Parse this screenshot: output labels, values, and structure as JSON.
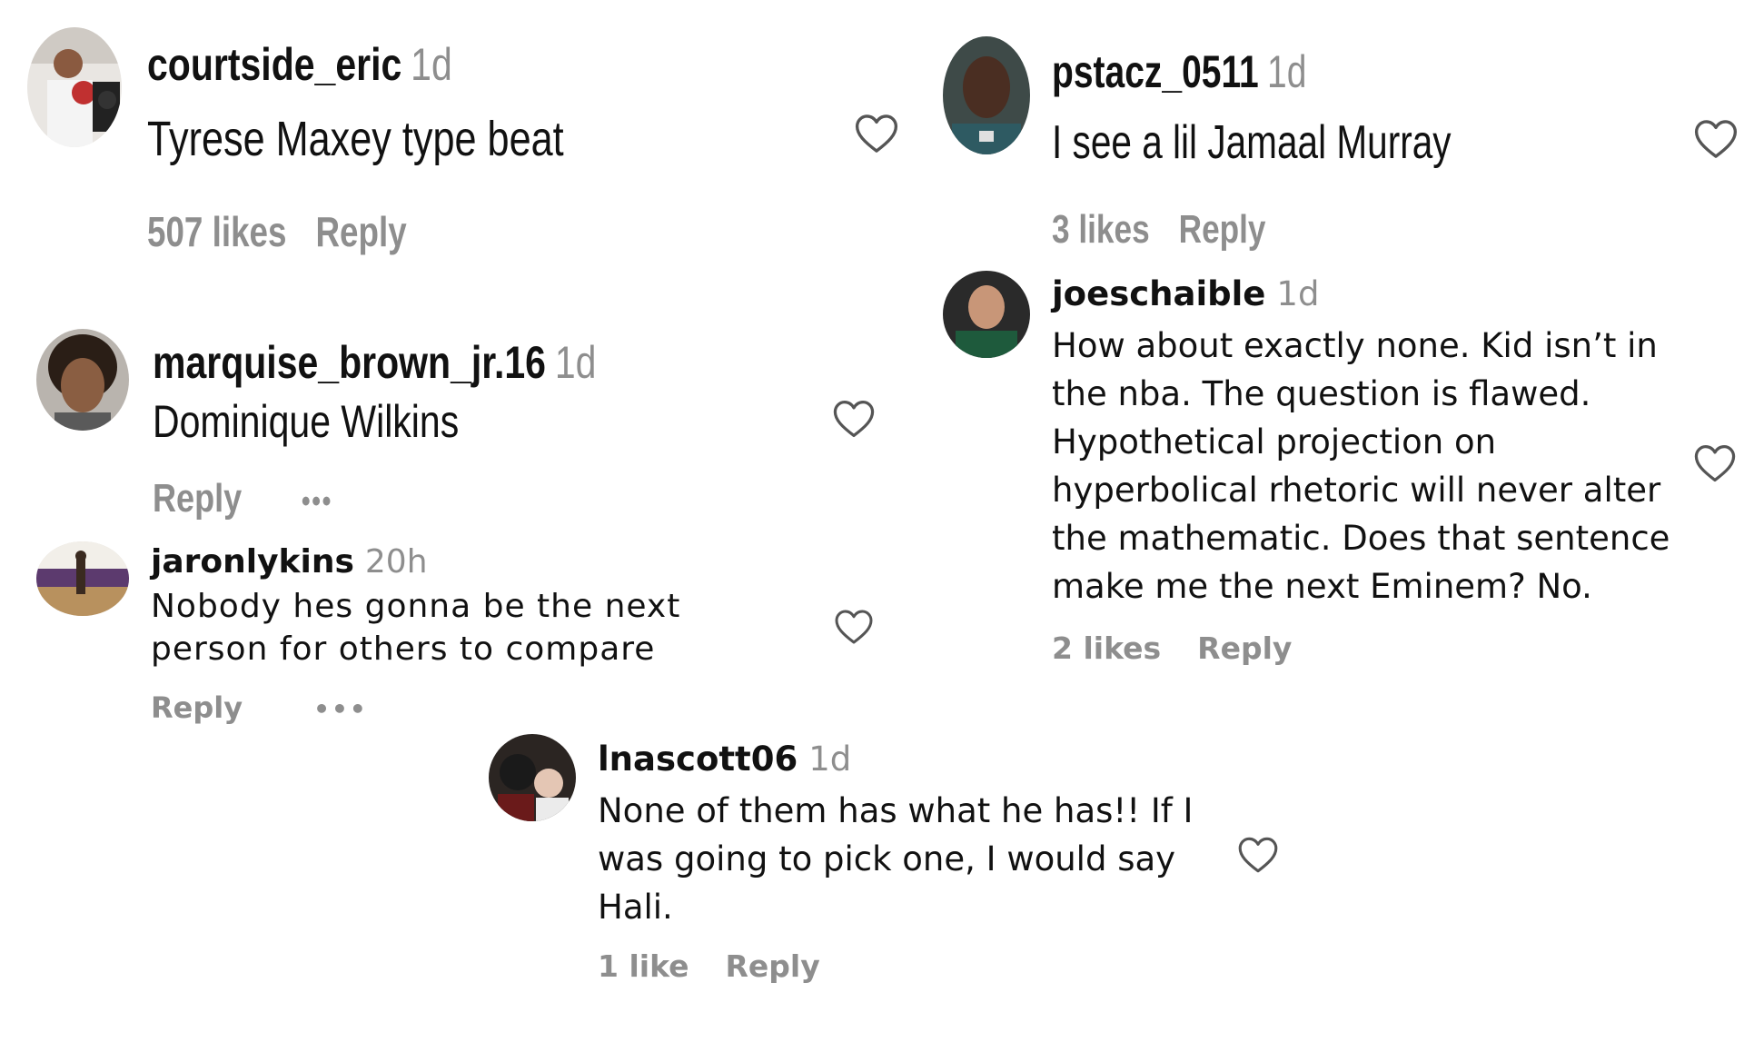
{
  "comments": [
    {
      "username": "courtside_eric",
      "time": "1d",
      "text": "Tyrese Maxey type beat",
      "likes": "507 likes",
      "reply": "Reply",
      "avatar": "avatar-boxing-photo"
    },
    {
      "username": "marquise_brown_jr.16",
      "time": "1d",
      "text": "Dominique Wilkins",
      "reply": "Reply",
      "more": "•••",
      "avatar": "avatar-portrait"
    },
    {
      "username": "jaronlykins",
      "time": "20h",
      "text_lines": [
        "Nobody hes gonna be the next",
        "person for others to compare"
      ],
      "reply": "Reply",
      "more": "•••",
      "avatar": "avatar-gym-photo"
    },
    {
      "username": "pstacz_0511",
      "time": "1d",
      "text": "I see a lil Jamaal Murray",
      "likes": "3 likes",
      "reply": "Reply",
      "avatar": "avatar-portrait"
    },
    {
      "username": "joeschaible",
      "time": "1d",
      "text_lines": [
        "How about exactly none. Kid isn’t in",
        "the nba. The question is flawed.",
        "Hypothetical projection on",
        "hyperbolical rhetoric will never alter",
        "the mathematic. Does that sentence",
        "make me the next Eminem? No."
      ],
      "likes": "2 likes",
      "reply": "Reply",
      "avatar": "avatar-portrait"
    },
    {
      "username": "lnascott06",
      "time": "1d",
      "text_lines": [
        "None of them has what he has!! If I",
        "was going to pick one, I would say",
        "Hali."
      ],
      "likes": "1 like",
      "reply": "Reply",
      "avatar": "avatar-couple-photo"
    }
  ],
  "icons": {
    "heart": "heart-outline-icon",
    "more": "more-options-icon"
  },
  "colors": {
    "text": "#111111",
    "muted": "#8e8e8e",
    "background": "#ffffff"
  }
}
